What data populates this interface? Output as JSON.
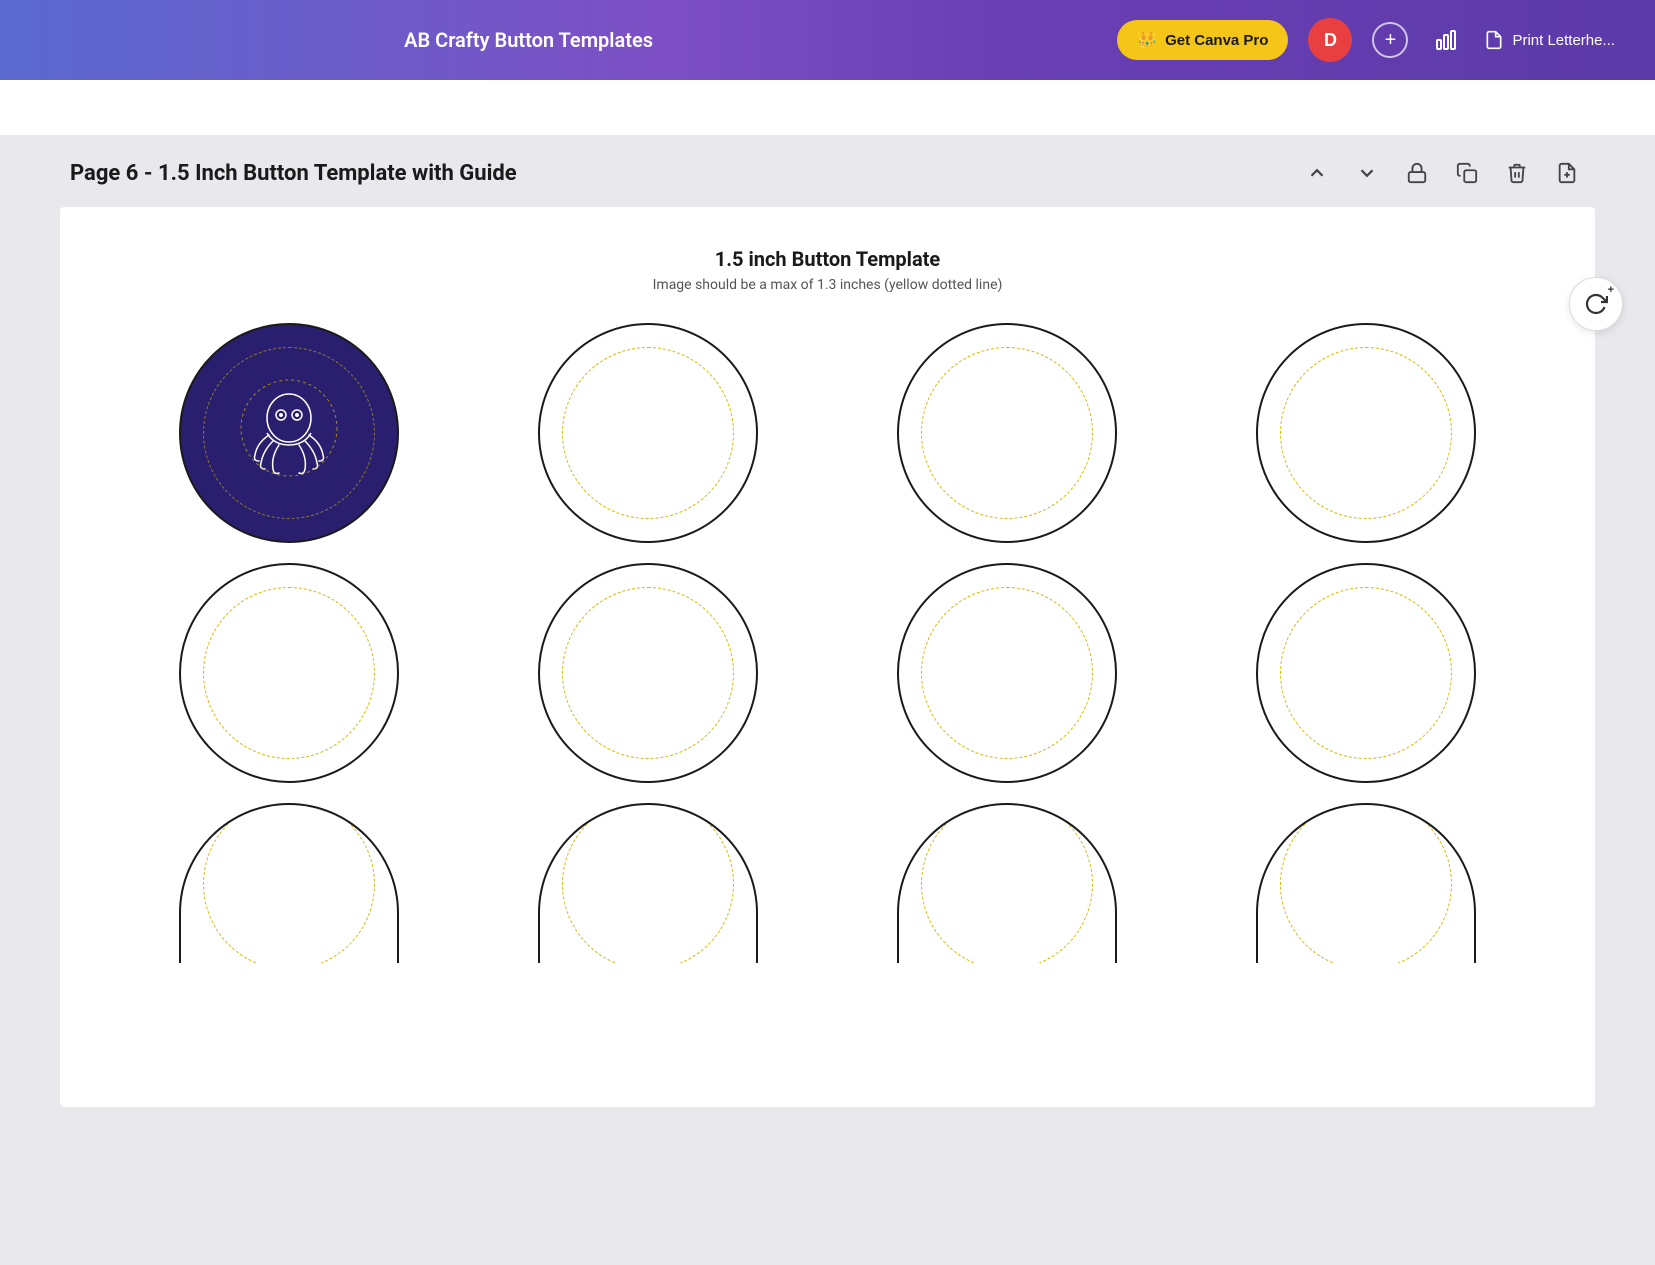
{
  "navbar": {
    "title": "AB Crafty Button Templates",
    "canva_pro_label": "Get Canva Pro",
    "avatar_initial": "D",
    "plus_symbol": "+",
    "print_label": "Print Letterhe...",
    "crown_icon": "👑",
    "chart_icon": "📊",
    "doc_icon": "📄"
  },
  "page": {
    "header_title": "Page 6 - 1.5 Inch Button Template with Guide",
    "canvas_title": "1.5 inch Button Template",
    "canvas_subtitle": "Image should be a max of 1.3 inches (yellow dotted line)",
    "actions": {
      "up_arrow": "∧",
      "down_arrow": "∨",
      "lock_icon": "🔓",
      "copy_icon": "⧉",
      "delete_icon": "🗑",
      "add_icon": "⊞"
    }
  },
  "grid": {
    "rows": 3,
    "cols": 4,
    "first_cell_filled": true,
    "total_circles": 12
  },
  "refresh_button": {
    "icon": "↻"
  }
}
